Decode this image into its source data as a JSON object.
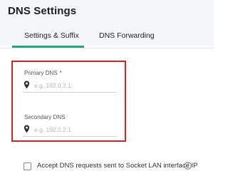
{
  "header": {
    "title": "DNS Settings"
  },
  "tabs": [
    {
      "label": "Settings & Suffix",
      "active": true
    },
    {
      "label": "DNS Forwarding",
      "active": false
    }
  ],
  "form": {
    "primary_dns": {
      "label": "Primary DNS",
      "required_mark": "*",
      "value": "",
      "placeholder": "e.g. 192.0.2.1",
      "icon": "map-pin-icon"
    },
    "secondary_dns": {
      "label": "Secondary DNS",
      "value": "",
      "placeholder": "e.g. 192.0.2.1",
      "icon": "map-pin-icon"
    },
    "accept_requests": {
      "label": "Accept DNS requests sent to Socket LAN interface IP",
      "checked": false,
      "help_icon": "question-circle-icon"
    }
  },
  "colors": {
    "accent": "#23a57a",
    "highlight": "#e01f1f",
    "required": "#e01f1f",
    "header_bg": "#f5f6f7"
  }
}
